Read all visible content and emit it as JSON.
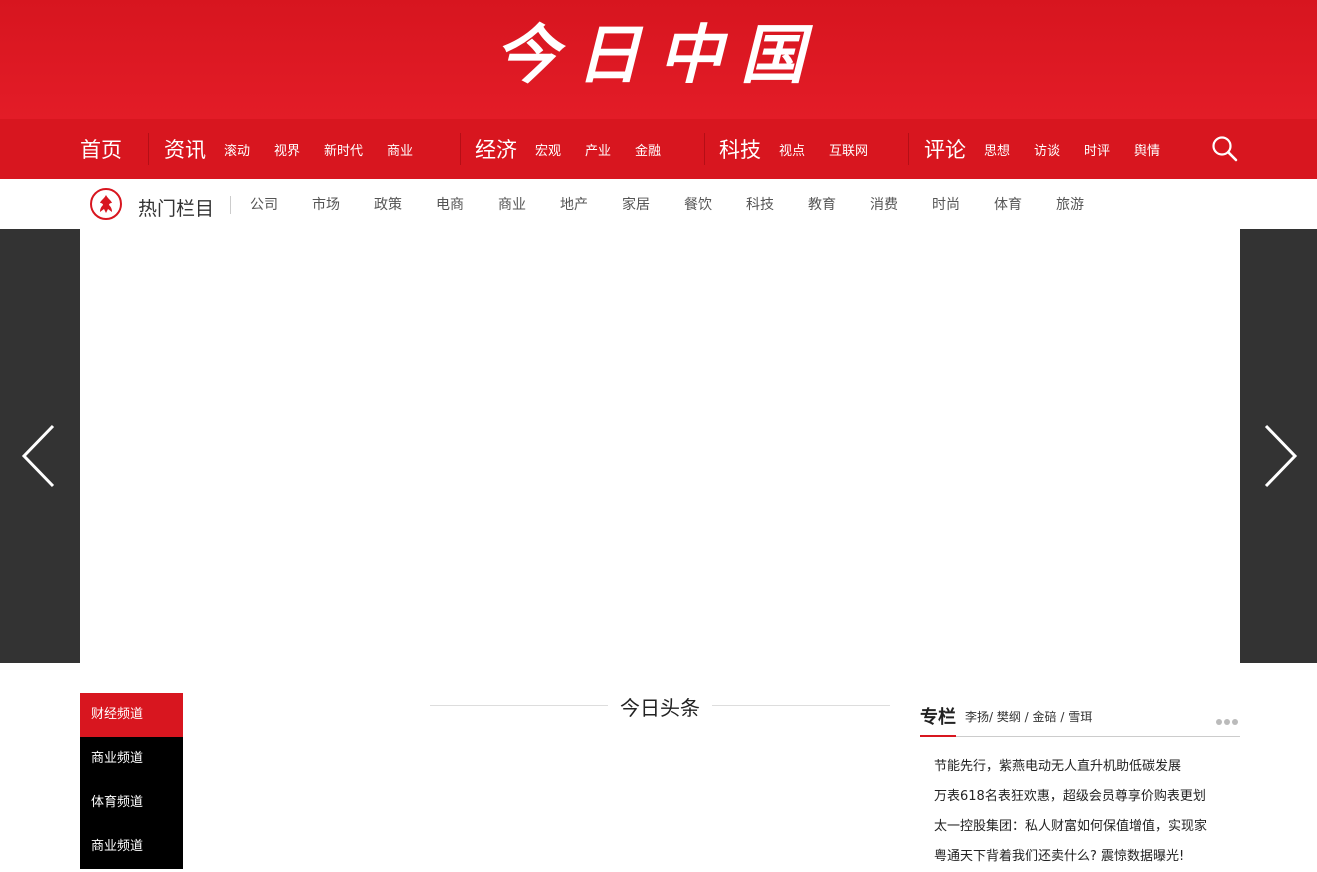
{
  "header": {
    "logo_text": "今日中国"
  },
  "colors": {
    "brand_red": "#d8161f",
    "dark": "#333333",
    "menu_black": "#000000"
  },
  "mainnav": {
    "groups": [
      {
        "title": "首页",
        "items": []
      },
      {
        "title": "资讯",
        "items": [
          "滚动",
          "视界",
          "新时代",
          "商业"
        ]
      },
      {
        "title": "经济",
        "items": [
          "宏观",
          "产业",
          "金融"
        ]
      },
      {
        "title": "科技",
        "items": [
          "视点",
          "互联网"
        ]
      },
      {
        "title": "评论",
        "items": [
          "思想",
          "访谈",
          "时评",
          "舆情"
        ]
      }
    ],
    "search_icon": "search-icon"
  },
  "hotbar": {
    "title": "热门栏目",
    "links": [
      "公司",
      "市场",
      "政策",
      "电商",
      "商业",
      "地产",
      "家居",
      "餐饮",
      "科技",
      "教育",
      "消费",
      "时尚",
      "体育",
      "旅游"
    ]
  },
  "slider": {
    "prev_icon": "chevron-left-icon",
    "next_icon": "chevron-right-icon"
  },
  "channels": [
    {
      "label": "财经频道",
      "active": true
    },
    {
      "label": "商业频道",
      "active": false
    },
    {
      "label": "体育频道",
      "active": false
    },
    {
      "label": "商业频道",
      "active": false
    }
  ],
  "headline": {
    "title": "今日头条"
  },
  "column": {
    "title": "专栏",
    "authors": "李扬/ 樊纲 / 金碚 / 雪珥",
    "items": [
      "节能先行，紫燕电动无人直升机助低碳发展",
      "万表618名表狂欢惠，超级会员尊享价购表更划",
      "太一控股集团：私人财富如何保值增值，实现家",
      "粤通天下背着我们还卖什么? 震惊数据曝光!"
    ]
  }
}
